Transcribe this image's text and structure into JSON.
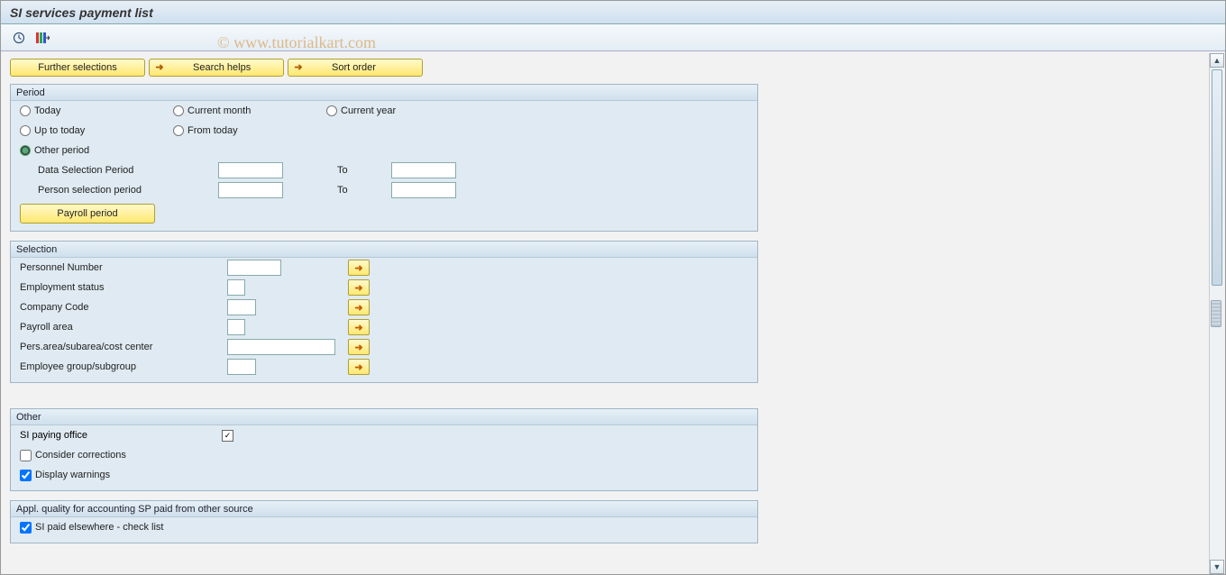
{
  "title": "SI services payment list",
  "watermark": "© www.tutorialkart.com",
  "topButtons": {
    "further": "Further selections",
    "searchHelps": "Search helps",
    "sortOrder": "Sort order"
  },
  "period": {
    "title": "Period",
    "today": "Today",
    "currentMonth": "Current month",
    "currentYear": "Current year",
    "upToToday": "Up to today",
    "fromToday": "From today",
    "otherPeriod": "Other period",
    "dataSelPeriod": "Data Selection Period",
    "personSelPeriod": "Person selection period",
    "to": "To",
    "payrollPeriod": "Payroll period",
    "values": {
      "dataFrom": "",
      "dataTo": "",
      "personFrom": "",
      "personTo": ""
    }
  },
  "selection": {
    "title": "Selection",
    "personnelNumber": "Personnel Number",
    "employmentStatus": "Employment status",
    "companyCode": "Company Code",
    "payrollArea": "Payroll area",
    "persArea": "Pers.area/subarea/cost center",
    "employeeGroup": "Employee group/subgroup",
    "values": {
      "personnelNumber": "",
      "employmentStatus": "",
      "companyCode": "",
      "payrollArea": "",
      "persArea": "",
      "employeeGroup": ""
    }
  },
  "other": {
    "title": "Other",
    "siPayingOffice": "SI paying office",
    "considerCorrections": "Consider corrections",
    "displayWarnings": "Display warnings"
  },
  "applQuality": {
    "title": "Appl. quality for accounting SP paid from other source",
    "siPaidElsewhere": "SI paid elsewhere - check list"
  }
}
